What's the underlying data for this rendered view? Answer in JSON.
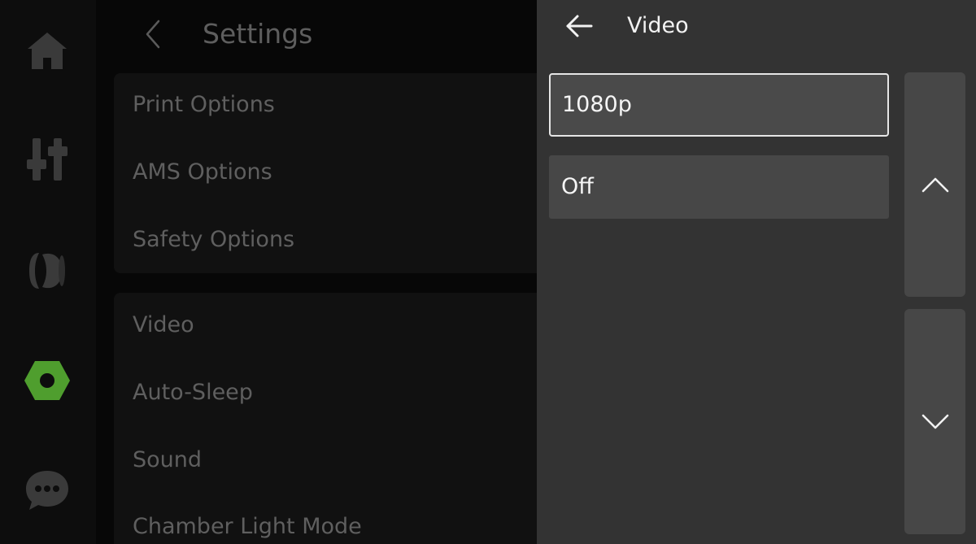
{
  "sidebar": {
    "items": [
      {
        "id": "home",
        "icon": "home-icon"
      },
      {
        "id": "controls",
        "icon": "sliders-icon"
      },
      {
        "id": "filament",
        "icon": "filament-spool-icon"
      },
      {
        "id": "settings",
        "icon": "hex-nut-icon",
        "active": true
      },
      {
        "id": "messages",
        "icon": "chat-bubble-icon"
      }
    ],
    "active_color": "#4f9e2e",
    "icon_color": "#3a3a3a"
  },
  "settings": {
    "title": "Settings",
    "groups": [
      {
        "items": [
          "Print Options",
          "AMS Options",
          "Safety Options"
        ]
      },
      {
        "items": [
          "Video",
          "Auto-Sleep",
          "Sound",
          "Chamber Light Mode"
        ]
      }
    ]
  },
  "video_panel": {
    "title": "Video",
    "options": [
      {
        "label": "1080p",
        "selected": true
      },
      {
        "label": "Off",
        "selected": false
      }
    ]
  }
}
